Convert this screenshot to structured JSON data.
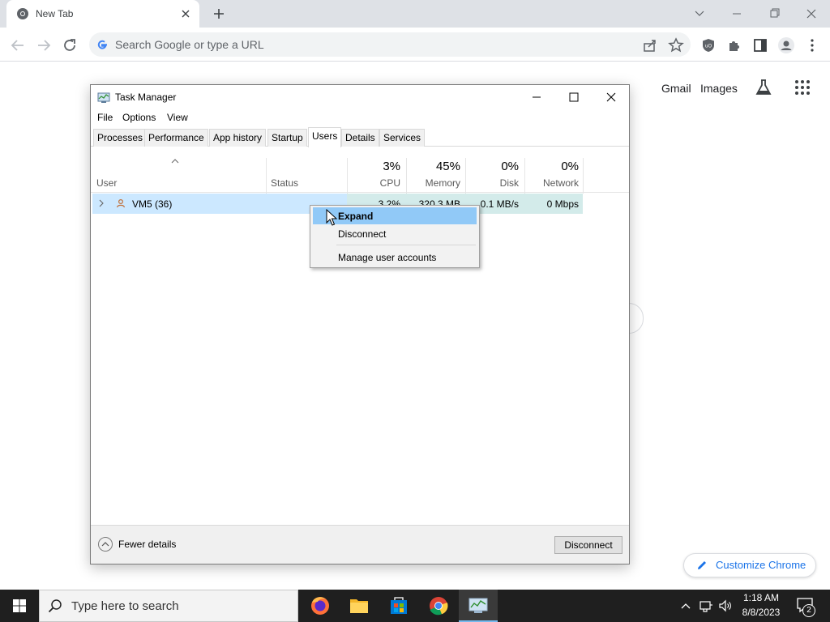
{
  "browser": {
    "tab_title": "New Tab",
    "omnibox_placeholder": "Search Google or type a URL",
    "ntp_links": {
      "gmail": "Gmail",
      "images": "Images"
    },
    "customize_label": "Customize Chrome"
  },
  "task_manager": {
    "title": "Task Manager",
    "menu": [
      "File",
      "Options",
      "View"
    ],
    "tabs": [
      "Processes",
      "Performance",
      "App history",
      "Startup",
      "Users",
      "Details",
      "Services"
    ],
    "active_tab": "Users",
    "columns": {
      "user": "User",
      "status": "Status",
      "cpu": {
        "pct": "3%",
        "label": "CPU"
      },
      "memory": {
        "pct": "45%",
        "label": "Memory"
      },
      "disk": {
        "pct": "0%",
        "label": "Disk"
      },
      "network": {
        "pct": "0%",
        "label": "Network"
      }
    },
    "rows": [
      {
        "user": "VM5 (36)",
        "status": "",
        "cpu": "3.2%",
        "memory": "320.3 MB",
        "disk": "0.1 MB/s",
        "network": "0 Mbps"
      }
    ],
    "footer": {
      "fewer_details": "Fewer details",
      "disconnect": "Disconnect"
    }
  },
  "context_menu": {
    "items": [
      "Expand",
      "Disconnect",
      "Manage user accounts"
    ],
    "highlighted": "Expand"
  },
  "taskbar": {
    "search_placeholder": "Type here to search",
    "time": "1:18 AM",
    "date": "8/8/2023",
    "notification_count": "2",
    "apps": [
      "firefox-icon",
      "file-explorer-icon",
      "store-icon",
      "chrome-icon",
      "task-manager-icon"
    ]
  },
  "colors": {
    "selection": "#cce8ff",
    "menu_highlight": "#91c9f7",
    "accent_link": "#1a73e8",
    "taskbar": "#1f1f1f"
  }
}
